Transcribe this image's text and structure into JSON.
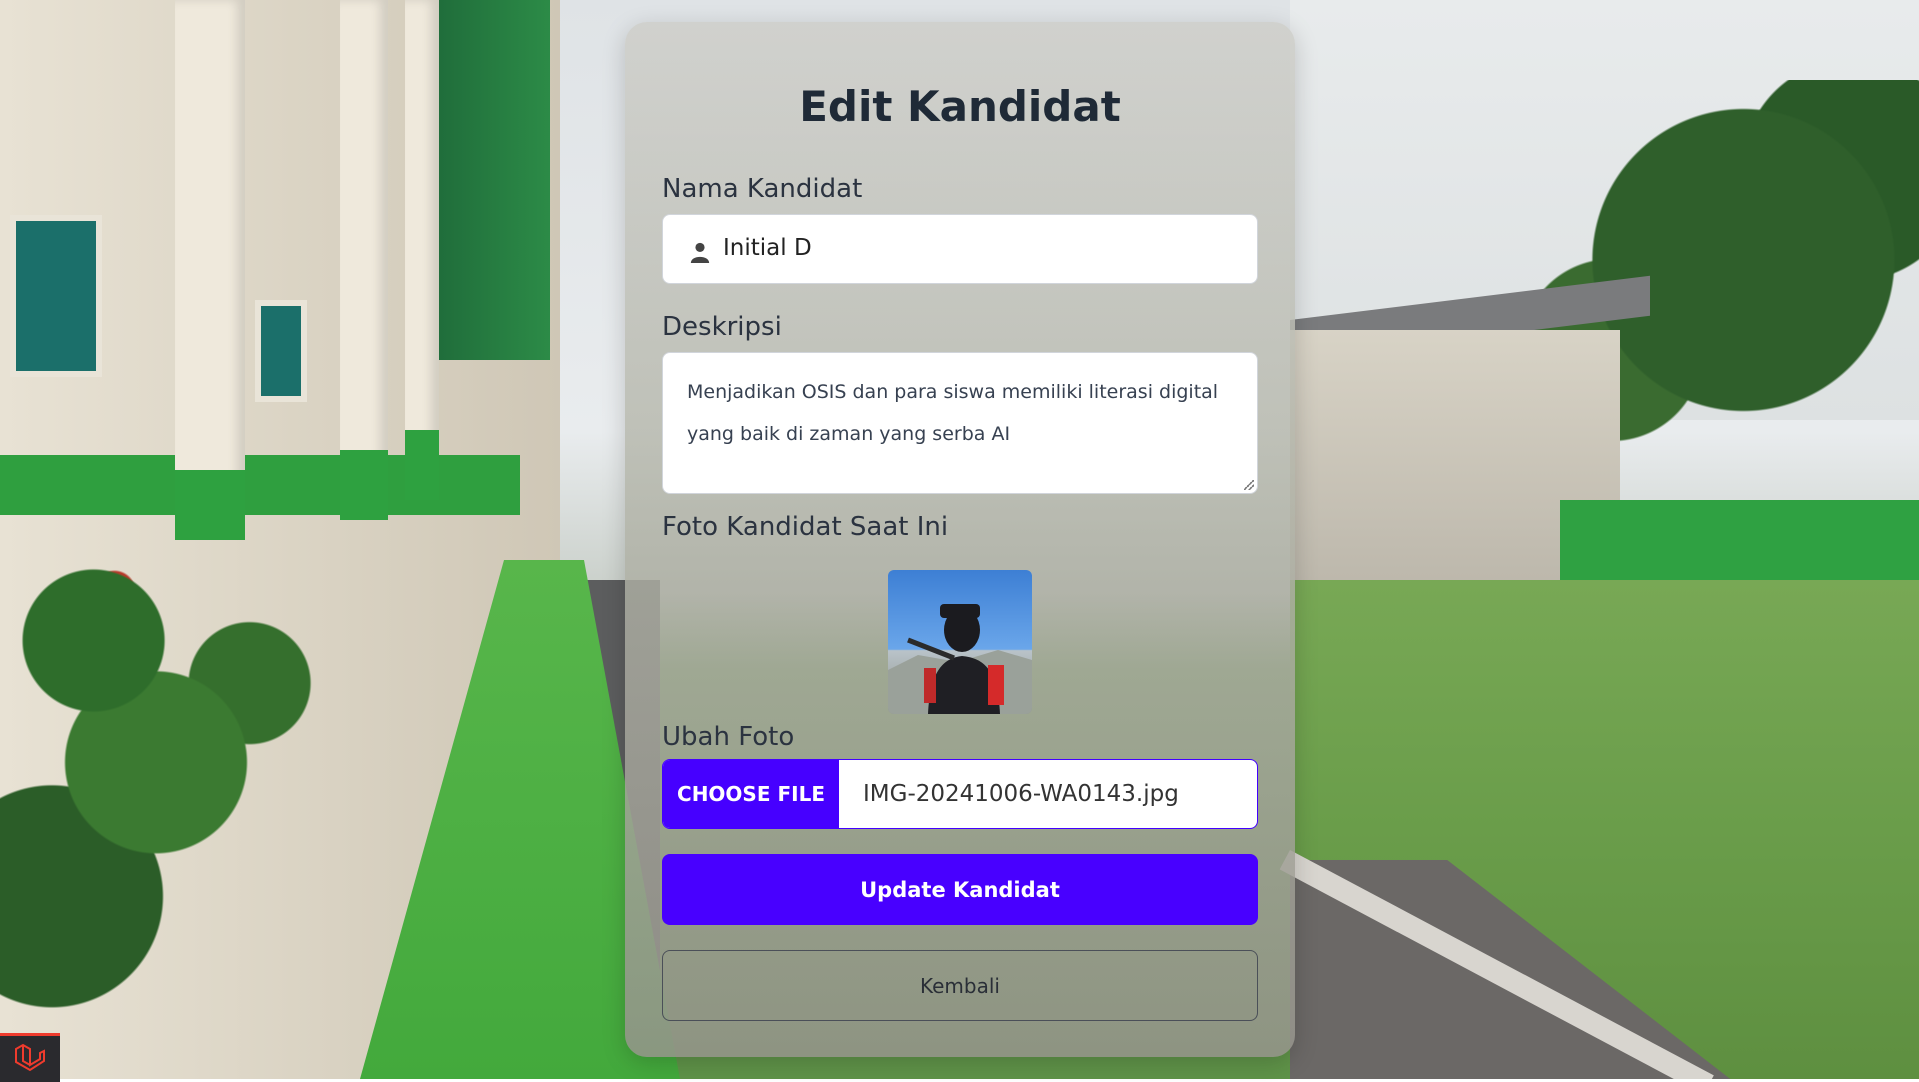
{
  "page": {
    "title": "Edit Kandidat"
  },
  "form": {
    "name_label": "Nama Kandidat",
    "name_value": "Initial D",
    "description_label": "Deskripsi",
    "description_value": "Menjadikan OSIS dan para siswa memiliki literasi digital yang baik di zaman yang serba AI",
    "current_photo_label": "Foto Kandidat Saat Ini",
    "change_photo_label": "Ubah Foto",
    "choose_file_label": "CHOOSE FILE",
    "file_name": "IMG-20241006-WA0143.jpg",
    "update_button": "Update Kandidat",
    "back_button": "Kembali"
  },
  "icons": {
    "name_field_icon": "user-icon",
    "debug_icon": "laravel-icon"
  },
  "colors": {
    "primary": "#4800ff",
    "title": "#1f2a37"
  }
}
